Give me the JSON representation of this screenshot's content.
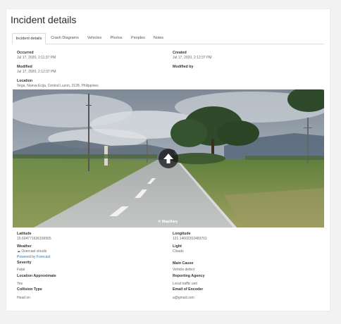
{
  "page": {
    "title": "Incident details"
  },
  "tabs": [
    {
      "label": "Incident details",
      "active": true
    },
    {
      "label": "Crash Diagrams",
      "active": false
    },
    {
      "label": "Vehicles",
      "active": false
    },
    {
      "label": "Photos",
      "active": false
    },
    {
      "label": "Peoples",
      "active": false
    },
    {
      "label": "Notes",
      "active": false
    }
  ],
  "details": {
    "occurred_label": "Occurred",
    "occurred_value": "Jul 17, 2020, 2:11:37 PM",
    "created_label": "Created",
    "created_value": "Jul 17, 2020, 2:12:37 PM",
    "modified_label": "Modified",
    "modified_value": "Jul 17, 2020, 2:12:37 PM",
    "modified_by_label": "Modified by",
    "modified_by_value": "",
    "location_label": "Location",
    "location_value": "Vega, Nueva Ecija, Central Luzon, 3128, Philippines"
  },
  "streetview": {
    "attribution": "Mapillary",
    "colors": {
      "sky": "#9aa6b2",
      "clouds": "#d8dde2",
      "road": "#b9bcbc",
      "grass": "#6f8a48",
      "trees": "#2f4a2a"
    }
  },
  "info": {
    "latitude_label": "Latitude",
    "latitude_value": "15.604771636156565",
    "longitude_label": "Longitude",
    "longitude_value": "121.14602202483701",
    "weather_label": "Weather",
    "weather_value": "Overcast clouds",
    "weather_link": "Powered by Forecast",
    "light_label": "Light",
    "light_value": "Clouds",
    "severity_label": "Severity",
    "severity_value": "Fatal",
    "main_cause_label": "Main Cause",
    "main_cause_value": "Vehicle defect",
    "location_approx_label": "Location Approximate",
    "location_approx_value": "Yes",
    "reporting_agency_label": "Reporting Agency",
    "reporting_agency_value": "Local traffic unit",
    "collision_label": "Collision Type",
    "collision_value": "Head on",
    "encoder_email_label": "Email of Encoder",
    "encoder_email_value": "a@gmail.com"
  }
}
